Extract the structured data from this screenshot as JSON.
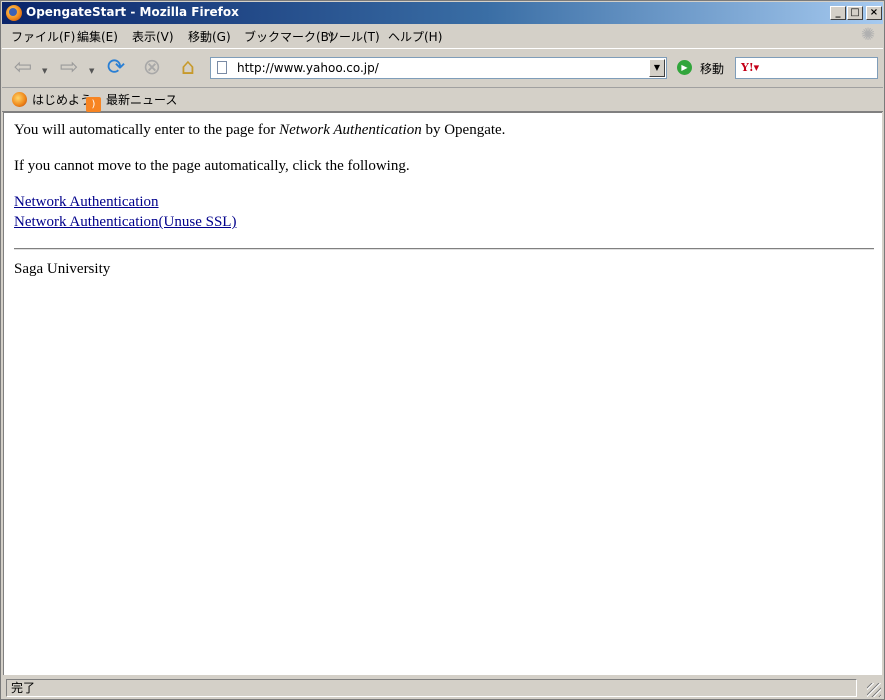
{
  "window": {
    "title": "OpengateStart - Mozilla Firefox"
  },
  "menu": [
    {
      "label": "ファイル(F)"
    },
    {
      "label": "編集(E)"
    },
    {
      "label": "表示(V)"
    },
    {
      "label": "移動(G)"
    },
    {
      "label": "ブックマーク(B)"
    },
    {
      "label": "ツール(T)"
    },
    {
      "label": "ヘルプ(H)"
    }
  ],
  "navbar": {
    "url": "http://www.yahoo.co.jp/",
    "go_label": "移動",
    "search_value": "",
    "icons": {
      "back": "back-arrow-icon",
      "forward": "forward-arrow-icon",
      "reload": "reload-icon",
      "stop": "stop-icon",
      "home": "home-icon",
      "go": "go-icon",
      "search_engine": "yahoo-icon"
    }
  },
  "bookmarks": [
    {
      "label": "はじめよう",
      "icon": "firefox-icon"
    },
    {
      "label": "最新ニュース",
      "icon": "rss-icon"
    }
  ],
  "content": {
    "p1_before": "You will automatically enter to the page for ",
    "p1_em": "Network Authentication",
    "p1_after": " by Opengate.",
    "p2": "If you cannot move to the page automatically, click the following.",
    "links": [
      {
        "label": "Network Authentication"
      },
      {
        "label": "Network Authentication(Unuse SSL)"
      }
    ],
    "footer": "Saga University"
  },
  "status": {
    "text": "完了"
  },
  "colors": {
    "link": "#00008b",
    "titlebar_start": "#0a246a",
    "titlebar_end": "#a6caf0"
  }
}
